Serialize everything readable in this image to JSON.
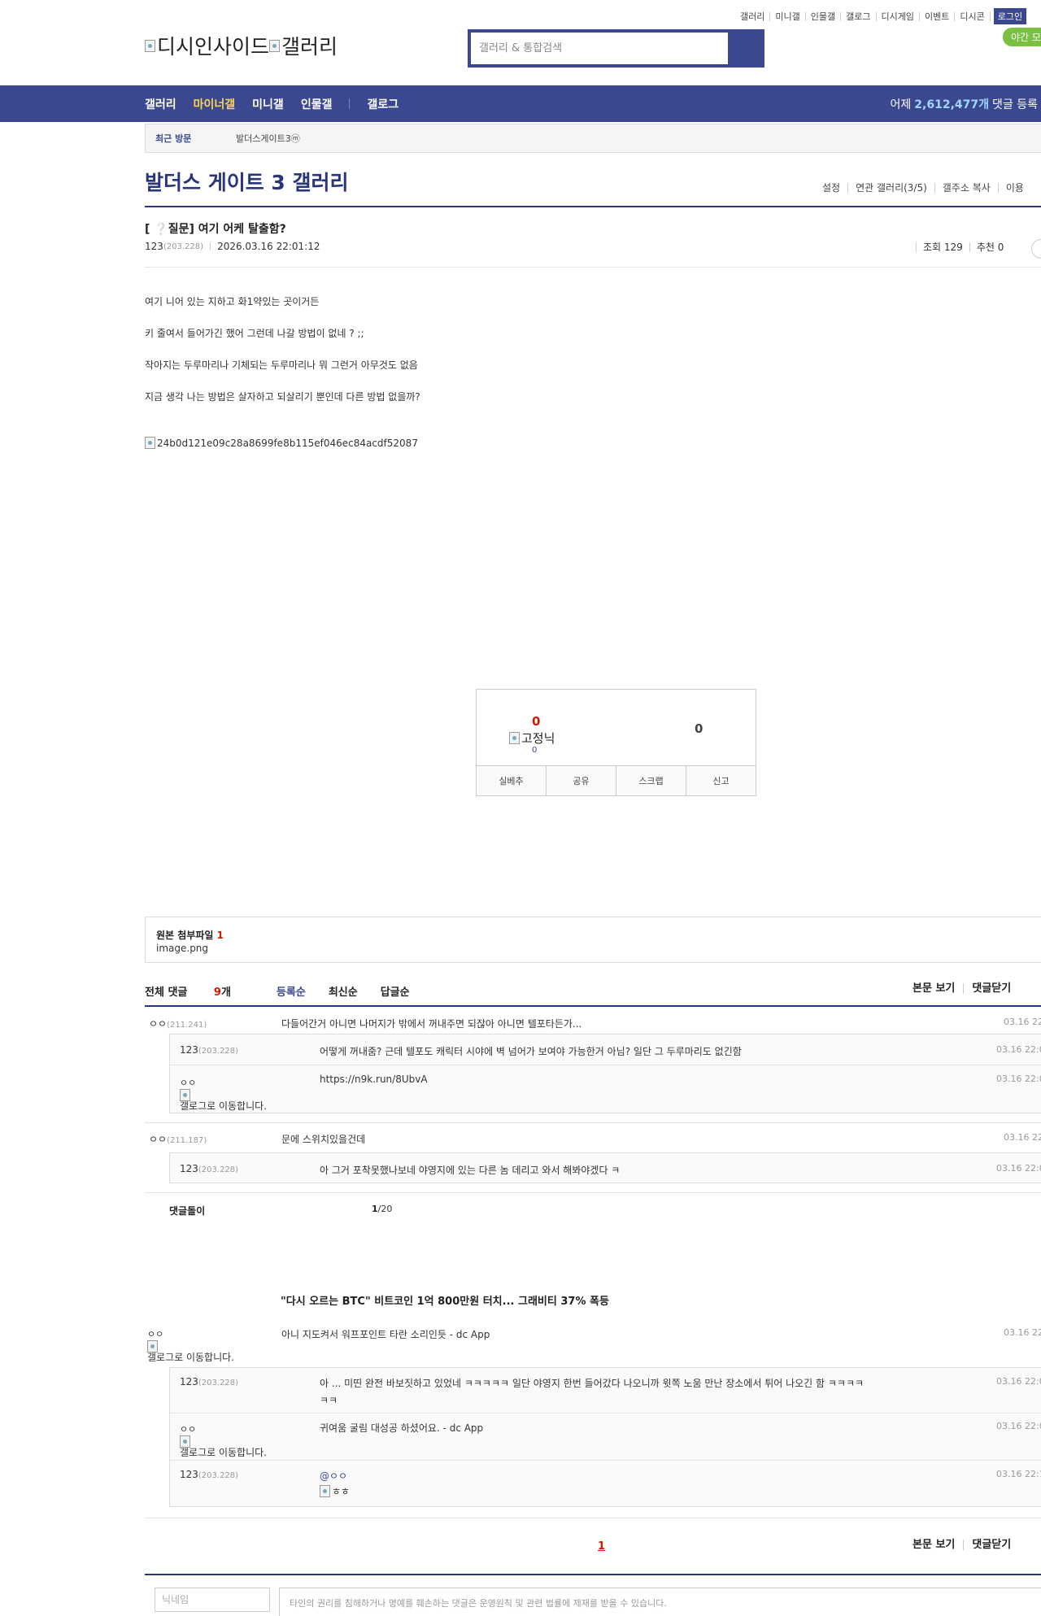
{
  "topnav": {
    "items": [
      "갤러리",
      "미니갤",
      "인물갤",
      "갤로그",
      "디시게임",
      "이벤트",
      "디시콘"
    ],
    "login": "로그인",
    "night": "야간 모드"
  },
  "logo": {
    "alt1": "디시인사이드",
    "alt2": "갤러리"
  },
  "search": {
    "placeholder": "갤러리 & 통합검색"
  },
  "gnb": {
    "items": [
      "갤러리",
      "마이너갤",
      "미니갤",
      "인물갤",
      "갤로그"
    ],
    "active_index": 1,
    "stat_prefix": "어제",
    "stat_value": "2,612,477개",
    "stat_suffix": "댓글 등록"
  },
  "recent": {
    "label": "최근 방문",
    "gallery": "발더스게이트3ⓜ"
  },
  "gallery": {
    "title": "발더스 게이트 3 갤러리",
    "menu": [
      "설정",
      "연관 갤러리(3/5)",
      "갤주소 복사",
      "이용"
    ]
  },
  "post": {
    "title": "[ ❔질문] 여기 어케 탈출함?",
    "author": "123",
    "author_ip": "(203.228)",
    "datetime": "2026.03.16 22:01:12",
    "views": "조회 129",
    "recommend": "추천 0",
    "body": [
      "여기 니어 있는 지하고 화1약있는 곳이거든",
      "키 줄여서 들어가긴 했어 그런데 나갈 방법이 없네 ? ;;",
      "작아지는 두루마리나 기체되는 두루마리나 뭐 그런거 아무것도 없음",
      "지금 생각 나는 방법은 살자하고 되살리기 뿐인데 다른 방법 없을까?"
    ],
    "image_alt": "24b0d121e09c28a8699fe8b115ef046ec84acdf52087"
  },
  "recommend": {
    "up": "0",
    "fix_alt": "고정닉",
    "fix_count": "0",
    "down": "0",
    "buttons": [
      "실베추",
      "공유",
      "스크랩",
      "신고"
    ]
  },
  "attach": {
    "label": "원본 첨부파일",
    "count": "1",
    "file": "image.png"
  },
  "comments_head": {
    "label": "전체 댓글",
    "count": "9",
    "unit": "개",
    "sort": [
      "등록순",
      "최신순",
      "답글순"
    ],
    "options": [
      "본문 보기",
      "댓글닫기"
    ]
  },
  "comments": {
    "c1": {
      "nick": "ㅇㅇ",
      "ip": "(211.241)",
      "text": "다들어간거 아니면 나머지가 밖에서 꺼내주면 되잖아 아니면 텔포타든가...",
      "date": "03.16 22"
    },
    "r1": {
      "nick": "123",
      "ip": "(203.228)",
      "text": "어떻게 꺼내줌? 근데 텔포도 캐릭터 시야에 벽 넘어가 보여야 가능한거 아님? 일단 그 두루마리도 없긴함",
      "date": "03.16 22:0"
    },
    "r2": {
      "nick": "ㅇㅇ",
      "galmove": "갤로그로 이동합니다.",
      "text": "https://n9k.run/8UbvA",
      "date": "03.16 22:0"
    },
    "c2": {
      "nick": "ㅇㅇ",
      "ip": "(211.187)",
      "text": "문에 스위치있을건데",
      "date": "03.16 22"
    },
    "r3": {
      "nick": "123",
      "ip": "(203.228)",
      "text": "아 그거 포착못했나보네 야영지에 있는 다른 놈 데리고 와서 해봐야겠다 ㅋ",
      "date": "03.16 22:0"
    },
    "dolbox": "댓글돌이",
    "dolpage": "1",
    "doltotal": "/20",
    "news": "\"다시 오르는 BTC\" 비트코인 1억 800만원 터치... 그래비티 37% 폭등",
    "c3": {
      "nick": "ㅇㅇ",
      "galmove": "갤로그로 이동합니다.",
      "text": "아니 지도켜서 워프포인트 타란 소리인듯 - dc App",
      "date": "03.16 22"
    },
    "r4": {
      "nick": "123",
      "ip": "(203.228)",
      "text1": "아 ... 미띤 완전 바보짓하고 있었네 ㅋㅋㅋㅋㅋ 일단 야영지 한번 들어갔다 나오니까 윗쪽 노움 만난 장소에서 튀어 나오긴 함 ㅋㅋㅋㅋ",
      "text2": "ㅋㅋ",
      "date": "03.16 22:0"
    },
    "r5": {
      "nick": "ㅇㅇ",
      "galmove": "갤로그로 이동합니다.",
      "text": "귀여움 굴림 대성공 하셨어요. - dc App",
      "date": "03.16 22:0"
    },
    "r6": {
      "nick": "123",
      "ip": "(203.228)",
      "mention": "@ㅇㅇ",
      "img_alt": "ㅎㅎ",
      "date": "03.16 22:1"
    }
  },
  "pager": {
    "current": "1"
  },
  "write": {
    "nick_placeholder": "닉네임",
    "notice": "타인의 권리를 침해하거나 명예를 훼손하는 댓글은 운영원칙 및 관련 법률에 제재를 받을 수 있습니다."
  },
  "colors": {
    "brand": "#3b4890",
    "accent": "#d31900",
    "gnb_active": "#f9d64f",
    "night": "#7ac142"
  }
}
